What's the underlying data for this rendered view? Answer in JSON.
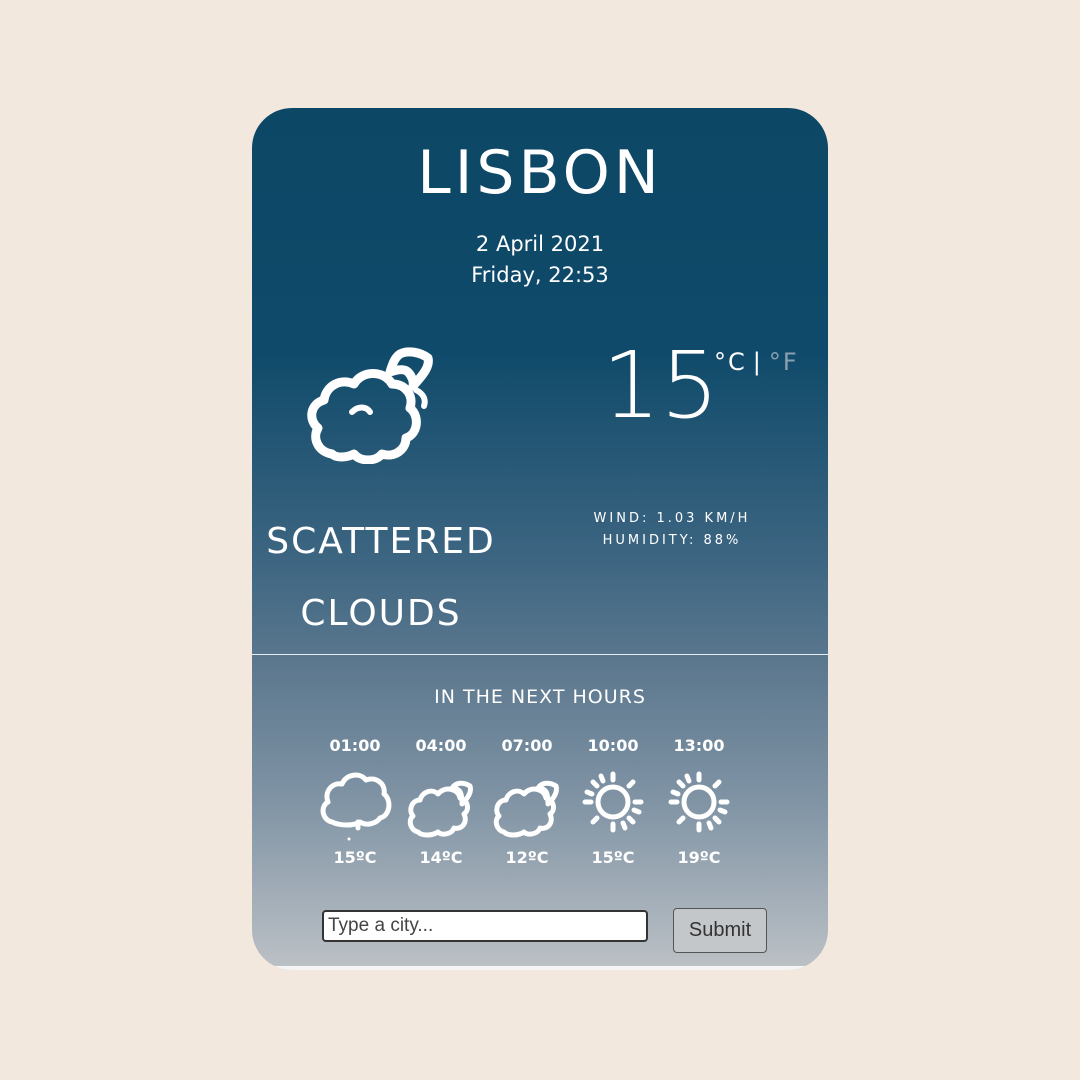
{
  "weather": {
    "city": "LISBON",
    "date": "2 April 2021",
    "day_time": "Friday, 22:53",
    "temperature": "15",
    "unit_c": "°C",
    "unit_separator": "|",
    "unit_f": "°F",
    "description_line1": "SCATTERED",
    "description_line2": "CLOUDS",
    "main_icon": "cloud-moon-icon",
    "wind": "WIND: 1.03 KM/H",
    "humidity": "HUMIDITY: 88%"
  },
  "forecast": {
    "title": "IN THE NEXT HOURS",
    "items": [
      {
        "time": "01:00",
        "icon": "cloud-drizzle-icon",
        "temp": "15ºC"
      },
      {
        "time": "04:00",
        "icon": "cloud-moon-icon",
        "temp": "14ºC"
      },
      {
        "time": "07:00",
        "icon": "cloud-moon-icon",
        "temp": "12ºC"
      },
      {
        "time": "10:00",
        "icon": "sun-icon",
        "temp": "15ºC"
      },
      {
        "time": "13:00",
        "icon": "sun-icon",
        "temp": "19ºC"
      }
    ]
  },
  "search": {
    "placeholder": "Type a city...",
    "submit_label": "Submit"
  }
}
